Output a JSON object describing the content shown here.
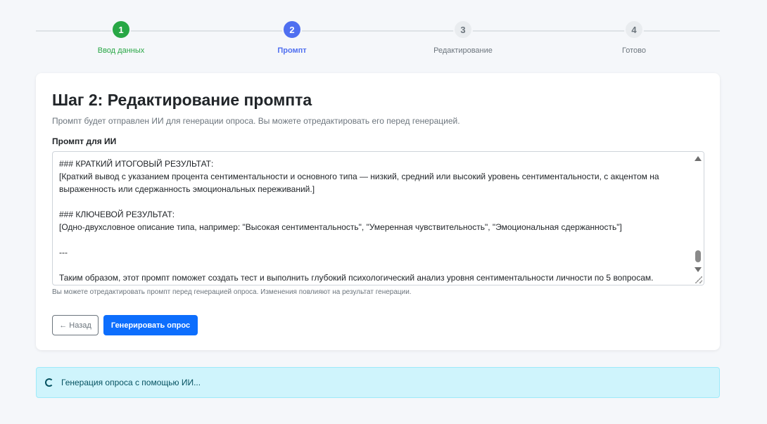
{
  "stepper": {
    "steps": [
      {
        "number": "1",
        "label": "Ввод данных",
        "state": "done"
      },
      {
        "number": "2",
        "label": "Промпт",
        "state": "active"
      },
      {
        "number": "3",
        "label": "Редактирование",
        "state": "todo"
      },
      {
        "number": "4",
        "label": "Готово",
        "state": "todo"
      }
    ]
  },
  "card": {
    "title": "Шаг 2: Редактирование промпта",
    "description": "Промпт будет отправлен ИИ для генерации опроса. Вы можете отредактировать его перед генерацией.",
    "field_label": "Промпт для ИИ",
    "prompt_value": "### КРАТКИЙ ИТОГОВЫЙ РЕЗУЛЬТАТ:\n[Краткий вывод с указанием процента сентиментальности и основного типа — низкий, средний или высокий уровень сентиментальности, с акцентом на выраженность или сдержанность эмоциональных переживаний.]\n\n### КЛЮЧЕВОЙ РЕЗУЛЬТАТ:\n[Одно-двухсловное описание типа, например: \"Высокая сентиментальность\", \"Умеренная чувствительность\", \"Эмоциональная сдержанность\"]\n\n---\n\nТаким образом, этот промпт поможет создать тест и выполнить глубокий психологический анализ уровня сентиментальности личности по 5 вопросам.",
    "help_text": "Вы можете отредактировать промпт перед генерацией опроса. Изменения повлияют на результат генерации.",
    "back_label": "← Назад",
    "generate_label": "Генерировать опрос"
  },
  "alert": {
    "text": "Генерация опроса с помощью ИИ..."
  },
  "colors": {
    "done": "#28a745",
    "active": "#4f6ff0",
    "primary": "#0d6efd",
    "alert_bg": "#cff4fc"
  }
}
